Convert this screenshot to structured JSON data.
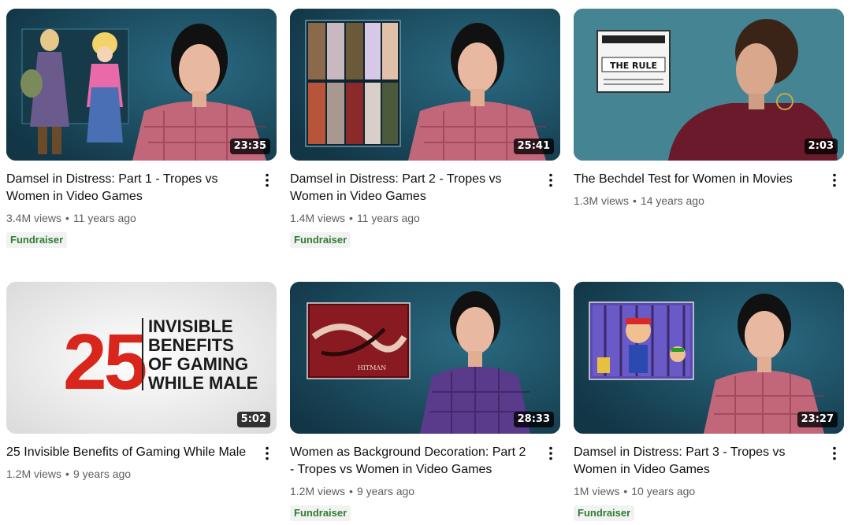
{
  "videos": [
    {
      "title": "Damsel in Distress: Part 1 - Tropes vs Women in Video Games",
      "duration": "23:35",
      "views": "3.4M views",
      "age": "11 years ago",
      "badge": "Fundraiser"
    },
    {
      "title": "Damsel in Distress: Part 2 - Tropes vs Women in Video Games",
      "duration": "25:41",
      "views": "1.4M views",
      "age": "11 years ago",
      "badge": "Fundraiser"
    },
    {
      "title": "The Bechdel Test for Women in Movies",
      "duration": "2:03",
      "views": "1.3M views",
      "age": "14 years ago",
      "badge": null,
      "thumb_text": {
        "sign_title": "THE RULE"
      }
    },
    {
      "title": "25 Invisible Benefits of Gaming While Male",
      "duration": "5:02",
      "views": "1.2M views",
      "age": "9 years ago",
      "badge": null,
      "thumb_text": {
        "number": "25",
        "line1": "INVISIBLE",
        "line2": "BENEFITS",
        "line3": "OF GAMING",
        "line4": "WHILE MALE"
      }
    },
    {
      "title": "Women as Background Decoration: Part 2 - Tropes vs Women in Video Games",
      "duration": "28:33",
      "views": "1.2M views",
      "age": "9 years ago",
      "badge": "Fundraiser",
      "thumb_text": {
        "poster_word": "HITMAN"
      }
    },
    {
      "title": "Damsel in Distress: Part 3 - Tropes vs Women in Video Games",
      "duration": "23:27",
      "views": "1M views",
      "age": "10 years ago",
      "badge": "Fundraiser"
    }
  ],
  "colors": {
    "teal_bg": "#1c4a5e",
    "fundraiser_green": "#2e7d32",
    "meta_gray": "#606060",
    "red_25": "#d8261c"
  },
  "icons": {
    "more": "more-vert-icon"
  }
}
